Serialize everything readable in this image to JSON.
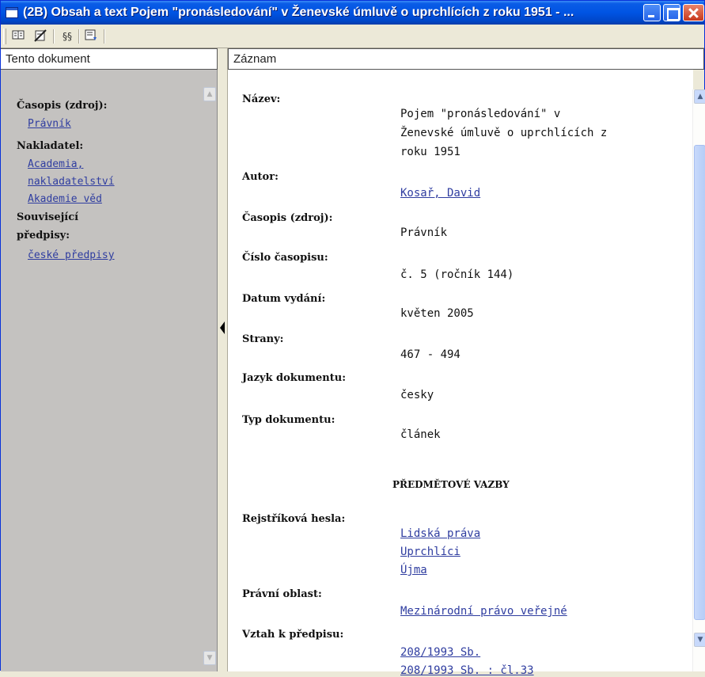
{
  "window": {
    "title": "(2B)  Obsah a text Pojem \"pronásledování\" v Ženevské úmluvě o uprchlících z roku 1951 - ..."
  },
  "toolbar": {
    "icons": [
      "document-view-icon",
      "no-edit-icon",
      "paragraph-sections-icon",
      "document-list-icon"
    ],
    "tool_3_glyph": "§§"
  },
  "left_panel": {
    "header": "Tento dokument",
    "sections": [
      {
        "label": "Časopis (zdroj):",
        "links": [
          "Právník"
        ]
      },
      {
        "label": "Nakladatel:",
        "links": [
          "Academia,",
          "nakladatelství",
          "Akademie věd"
        ]
      },
      {
        "label_lines": [
          "Související",
          "předpisy:"
        ],
        "links": [
          "české předpisy"
        ]
      }
    ]
  },
  "right_panel": {
    "header": "Záznam",
    "fields": {
      "nazev": {
        "label": "Název:",
        "value_lines": [
          "Pojem   \"pronásledování\"   v",
          "Ženevské úmluvě o uprchlících z",
          "roku 1951"
        ]
      },
      "autor": {
        "label": "Autor:",
        "link": "Kosař, David"
      },
      "casopis": {
        "label": "Časopis (zdroj):",
        "value": "Právník"
      },
      "cislo": {
        "label": "Číslo časopisu:",
        "value": "č. 5 (ročník 144)"
      },
      "datum": {
        "label": "Datum vydání:",
        "value": "květen 2005"
      },
      "strany": {
        "label": "Strany:",
        "value": "467 - 494"
      },
      "jazyk": {
        "label": "Jazyk dokumentu:",
        "value": "česky"
      },
      "typ": {
        "label": "Typ dokumentu:",
        "value": "článek"
      }
    },
    "section_heading": "PŘEDMĚTOVÉ VAZBY",
    "rejstrikova": {
      "label": "Rejstříková hesla:",
      "links": [
        "Lidská práva",
        "Uprchlíci",
        "Újma"
      ]
    },
    "pravni_oblast": {
      "label": "Právní oblast:",
      "links": [
        "Mezinárodní právo veřejné"
      ]
    },
    "vztah": {
      "label": "Vztah k předpisu:",
      "links": [
        "208/1993 Sb.",
        "208/1993 Sb. : čl.33"
      ]
    }
  },
  "colors": {
    "title_bar": "#0054e3",
    "link": "#2f3da0",
    "left_panel_bg": "#c4c2c0"
  }
}
